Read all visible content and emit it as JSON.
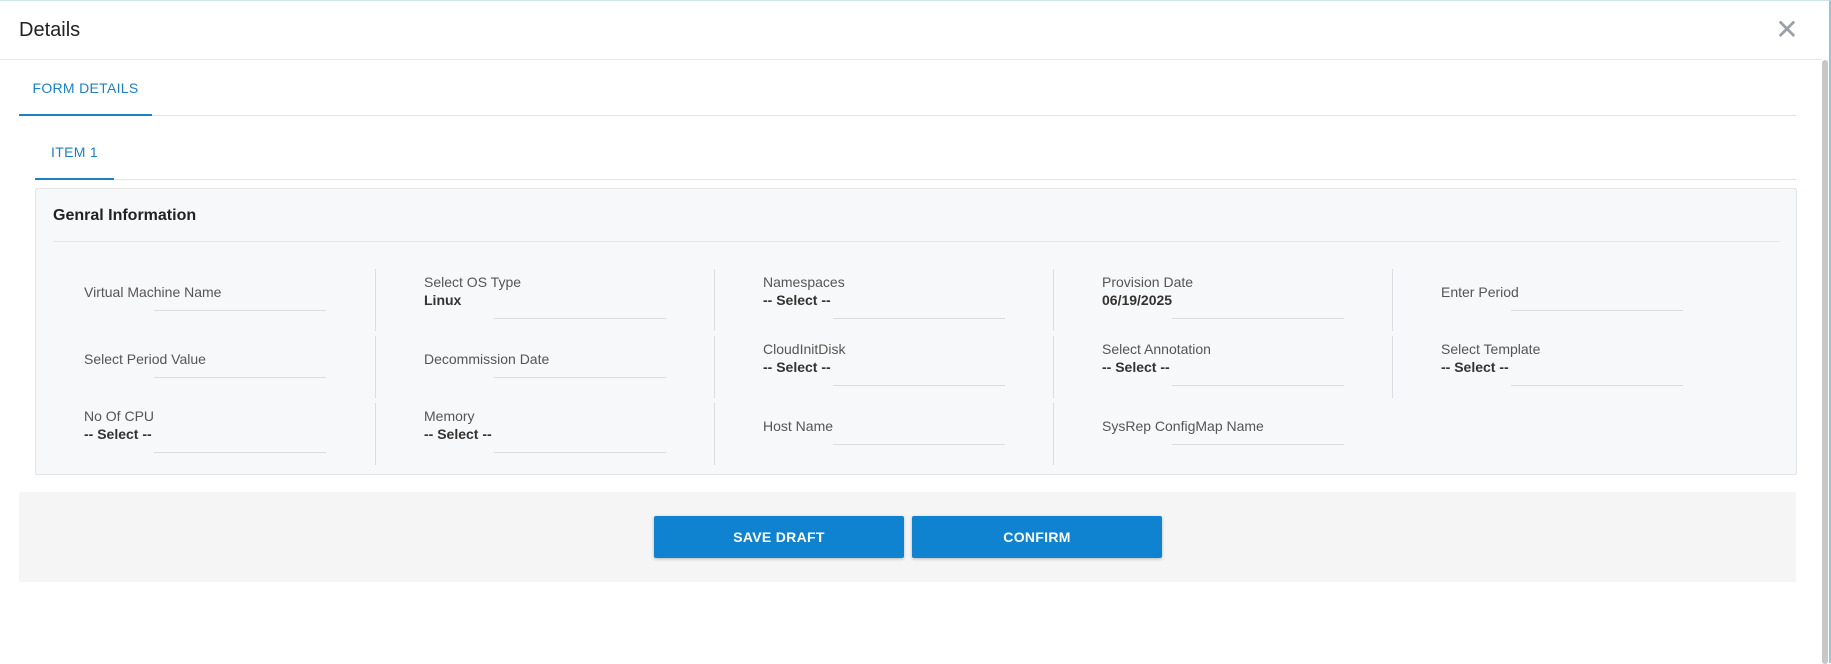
{
  "dialog": {
    "title": "Details"
  },
  "tabs": {
    "outer": [
      {
        "label": "FORM DETAILS",
        "active": true
      }
    ],
    "inner": [
      {
        "label": "ITEM 1",
        "active": true
      }
    ]
  },
  "section": {
    "title": "Genral Information",
    "fields": {
      "vm_name": {
        "label": "Virtual Machine Name",
        "value": ""
      },
      "os_type": {
        "label": "Select OS Type",
        "value": "Linux"
      },
      "namespaces": {
        "label": "Namespaces",
        "value": "-- Select --"
      },
      "provision_date": {
        "label": "Provision Date",
        "value": "06/19/2025"
      },
      "enter_period": {
        "label": "Enter Period",
        "value": ""
      },
      "period_value": {
        "label": "Select Period Value",
        "value": ""
      },
      "decommission_date": {
        "label": "Decommission Date",
        "value": ""
      },
      "cloudinit_disk": {
        "label": "CloudInitDisk",
        "value": "-- Select --"
      },
      "annotation": {
        "label": "Select Annotation",
        "value": "-- Select --"
      },
      "template": {
        "label": "Select Template",
        "value": "-- Select --"
      },
      "cpu": {
        "label": "No Of CPU",
        "value": "-- Select --"
      },
      "memory": {
        "label": "Memory",
        "value": "-- Select --"
      },
      "host_name": {
        "label": "Host Name",
        "value": ""
      },
      "sysrep_configmap": {
        "label": "SysRep ConfigMap Name",
        "value": ""
      }
    }
  },
  "footer": {
    "save_draft_label": "SAVE DRAFT",
    "confirm_label": "CONFIRM"
  },
  "icons": {
    "close": "close-icon"
  },
  "colors": {
    "accent": "#1e7fc4",
    "button": "#0f83cf",
    "panel_bg": "#f7f8fa",
    "footer_bg": "#f5f5f5"
  }
}
